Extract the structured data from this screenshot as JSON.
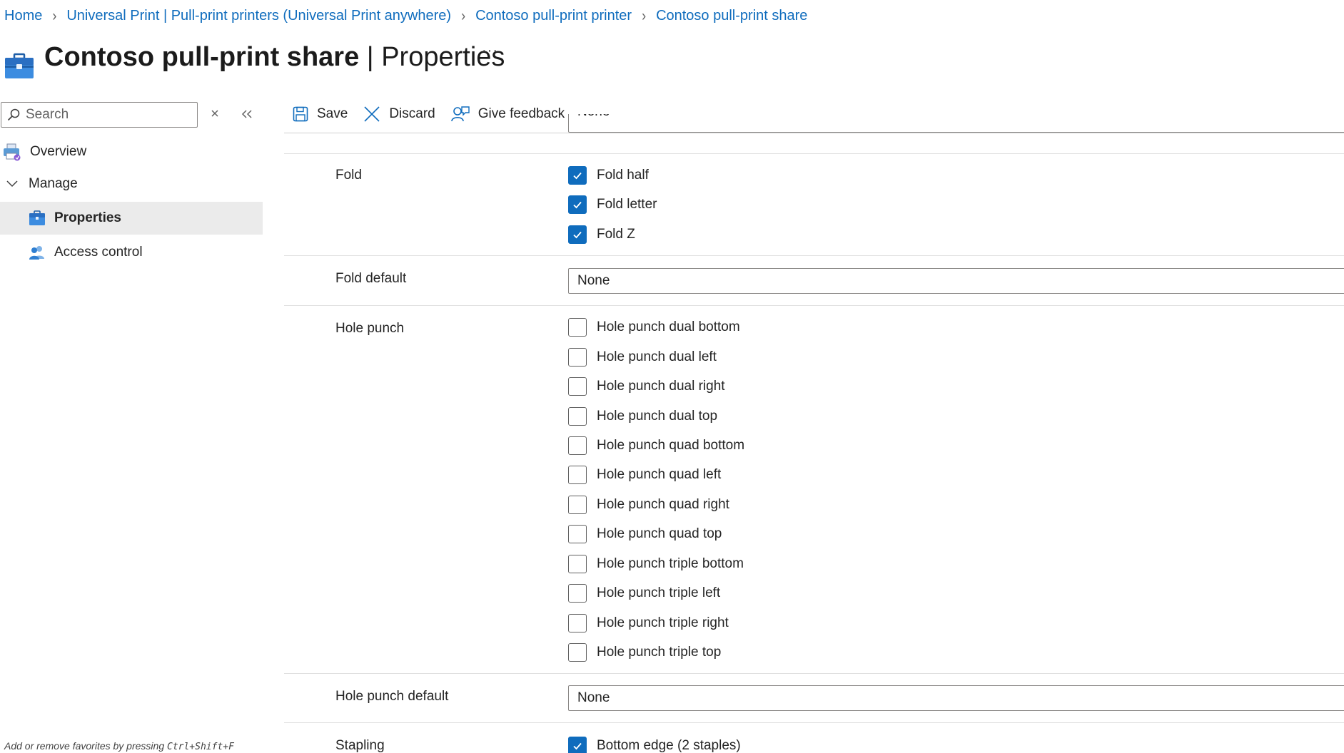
{
  "breadcrumb": [
    "Home",
    "Universal Print | Pull-print printers (Universal Print anywhere)",
    "Contoso pull-print printer",
    "Contoso pull-print share"
  ],
  "title": {
    "bold": "Contoso pull-print share",
    "rest": " | Properties",
    "more": "···"
  },
  "sidebar": {
    "search_placeholder": "Search",
    "items": [
      {
        "label": "Overview"
      },
      {
        "label": "Manage"
      },
      {
        "label": "Properties"
      },
      {
        "label": "Access control"
      }
    ],
    "favorites_hint": "Add or remove favorites by pressing ",
    "favorites_keys": "Ctrl+Shift+F"
  },
  "toolbar": {
    "save": "Save",
    "discard": "Discard",
    "feedback": "Give feedback"
  },
  "properties": {
    "partial_value": "None",
    "fold": {
      "label": "Fold",
      "options": [
        {
          "label": "Fold half",
          "checked": true
        },
        {
          "label": "Fold letter",
          "checked": true
        },
        {
          "label": "Fold Z",
          "checked": true
        }
      ]
    },
    "fold_default": {
      "label": "Fold default",
      "value": "None"
    },
    "hole_punch": {
      "label": "Hole punch",
      "options": [
        {
          "label": "Hole punch dual bottom",
          "checked": false
        },
        {
          "label": "Hole punch dual left",
          "checked": false
        },
        {
          "label": "Hole punch dual right",
          "checked": false
        },
        {
          "label": "Hole punch dual top",
          "checked": false
        },
        {
          "label": "Hole punch quad bottom",
          "checked": false
        },
        {
          "label": "Hole punch quad left",
          "checked": false
        },
        {
          "label": "Hole punch quad right",
          "checked": false
        },
        {
          "label": "Hole punch quad top",
          "checked": false
        },
        {
          "label": "Hole punch triple bottom",
          "checked": false
        },
        {
          "label": "Hole punch triple left",
          "checked": false
        },
        {
          "label": "Hole punch triple right",
          "checked": false
        },
        {
          "label": "Hole punch triple top",
          "checked": false
        }
      ]
    },
    "hole_punch_default": {
      "label": "Hole punch default",
      "value": "None"
    },
    "stapling": {
      "label": "Stapling",
      "options": [
        {
          "label": "Bottom edge (2 staples)",
          "checked": true
        }
      ]
    }
  },
  "colors": {
    "accent": "#0f6cbd",
    "selected_bg": "#ebebeb",
    "border": "#8a8886"
  }
}
